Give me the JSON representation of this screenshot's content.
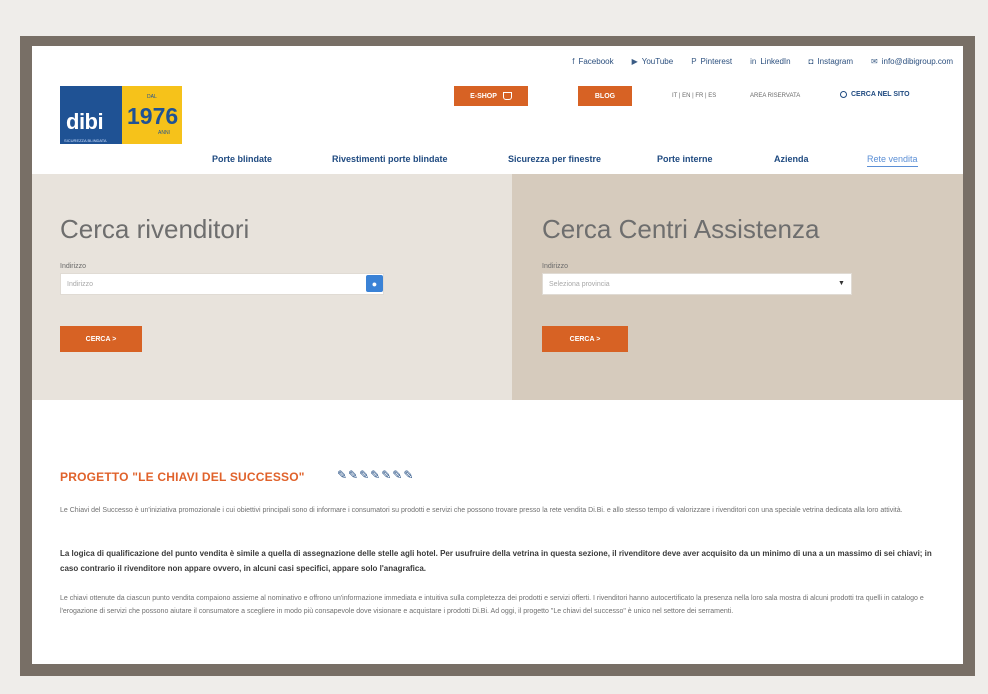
{
  "topbar": {
    "social": [
      {
        "icon": "facebook-icon",
        "glyph": "f",
        "label": "Facebook"
      },
      {
        "icon": "youtube-icon",
        "glyph": "▶",
        "label": "YouTube"
      },
      {
        "icon": "pinterest-icon",
        "glyph": "P",
        "label": "Pinterest"
      },
      {
        "icon": "linkedin-icon",
        "glyph": "in",
        "label": "LinkedIn"
      },
      {
        "icon": "instagram-icon",
        "glyph": "◘",
        "label": "Instagram"
      },
      {
        "icon": "email-icon",
        "glyph": "✉",
        "label": "info@dibigroup.com"
      }
    ]
  },
  "logo": {
    "brand": "dibi",
    "year": "1976",
    "dal": "DAL",
    "tagline": "SICUREZZA BLINDATA",
    "years_text": "ANNI"
  },
  "header": {
    "eshop_label": "E-SHOP",
    "blog_label": "BLOG",
    "phone": "IT | EN | FR | ES",
    "reserved": "AREA RISERVATA",
    "search_label": "CERCA NEL SITO"
  },
  "nav": [
    {
      "label": "Porte blindate"
    },
    {
      "label": "Rivestimenti porte blindate"
    },
    {
      "label": "Sicurezza per finestre"
    },
    {
      "label": "Porte interne"
    },
    {
      "label": "Azienda"
    },
    {
      "label": "Rete vendita"
    }
  ],
  "left_panel": {
    "title": "Cerca rivenditori",
    "field_label": "Indirizzo",
    "placeholder": "Indirizzo",
    "button_label": "CERCA  >"
  },
  "right_panel": {
    "title": "Cerca Centri Assistenza",
    "field_label": "Indirizzo",
    "select_value": "Seleziona provincia",
    "button_label": "CERCA  >"
  },
  "section": {
    "title": "PROGETTO \"LE CHIAVI DEL SUCCESSO\"",
    "keys": "✎✎✎✎✎✎✎",
    "p1": "Le Chiavi del Successo è un'iniziativa promozionale i cui obiettivi principali sono di informare i consumatori su prodotti e servizi che possono trovare presso la rete vendita Di.Bi. e allo stesso tempo di valorizzare i rivenditori con una speciale vetrina dedicata alla loro attività.",
    "p2": "La logica di qualificazione del punto vendita è simile a quella di assegnazione delle stelle agli hotel. Per usufruire della vetrina in questa sezione, il rivenditore deve aver acquisito da un minimo di una a un massimo di sei chiavi; in caso contrario il rivenditore non appare ovvero, in alcuni casi specifici, appare solo l'anagrafica.",
    "p3": "Le chiavi ottenute da ciascun punto vendita compaiono assieme al nominativo e offrono un'informazione immediata e intuitiva sulla completezza dei prodotti e servizi offerti. I rivenditori hanno autocertificato la presenza nella loro sala mostra di alcuni prodotti tra quelli in catalogo e l'erogazione di servizi che possono aiutare il consumatore a scegliere in modo più consapevole dove visionare e acquistare i prodotti Di.Bi. Ad oggi, il progetto \"Le chiavi del successo\" è unico nel settore dei serramenti."
  },
  "colors": {
    "accent": "#d76224",
    "brand_blue": "#1f5294",
    "brand_yellow": "#f6c21a"
  }
}
